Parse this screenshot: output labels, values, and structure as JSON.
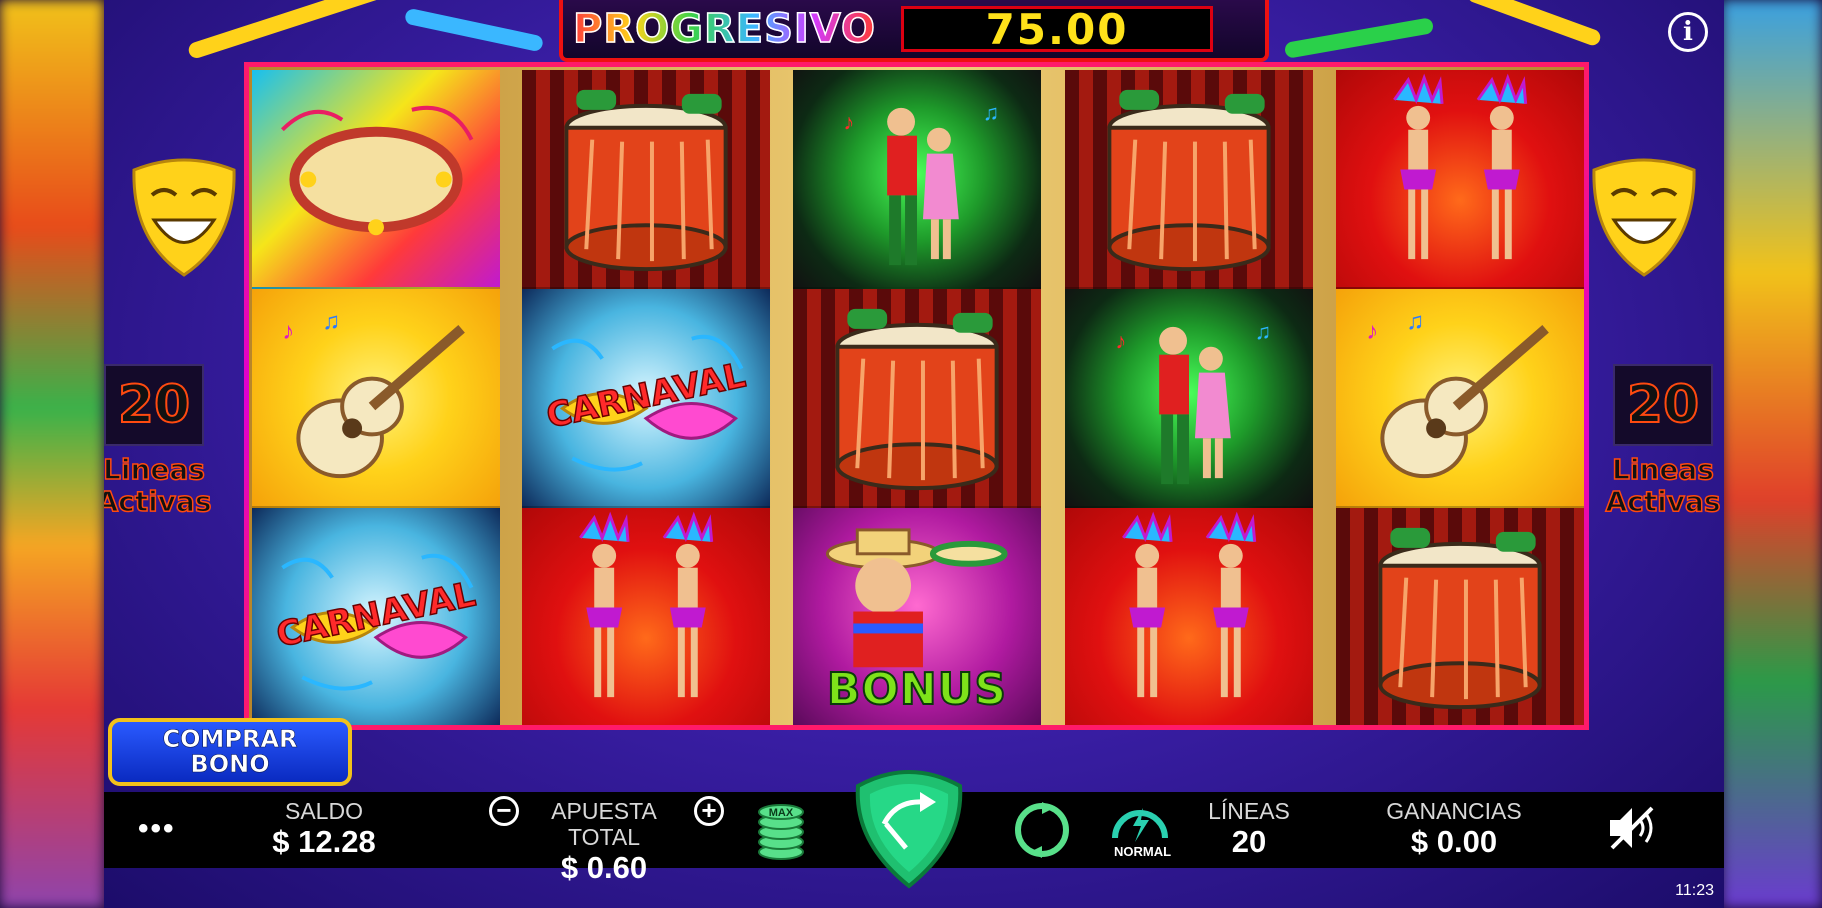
{
  "jackpot": {
    "label": "PROGRESIVO",
    "value": "75.00"
  },
  "lines_panel": {
    "count": "20",
    "line1": "Lineas",
    "line2": "Activas"
  },
  "reels": [
    [
      "tambourine",
      "guitar",
      "carnaval"
    ],
    [
      "drum",
      "carnaval",
      "dancers"
    ],
    [
      "dance",
      "drum",
      "bonus"
    ],
    [
      "drum",
      "dance",
      "dancers"
    ],
    [
      "dancers",
      "guitar",
      "drum"
    ]
  ],
  "symbols": {
    "bonus_text": "BONUS",
    "carnaval_text": "CARNAVAL"
  },
  "buy_bonus": {
    "line1": "COMPRAR",
    "line2": "BONO"
  },
  "bar": {
    "menu": "•••",
    "saldo_label": "SALDO",
    "saldo_value": "$ 12.28",
    "apuesta_label": "APUESTA TOTAL",
    "apuesta_value": "$ 0.60",
    "minus": "−",
    "plus": "+",
    "max_label": "MAX",
    "speed_label": "NORMAL",
    "lineas_label": "LÍNEAS",
    "lineas_value": "20",
    "ganancias_label": "GANANCIAS",
    "ganancias_value": "$ 0.00"
  },
  "clock": "11:23",
  "info": "i"
}
